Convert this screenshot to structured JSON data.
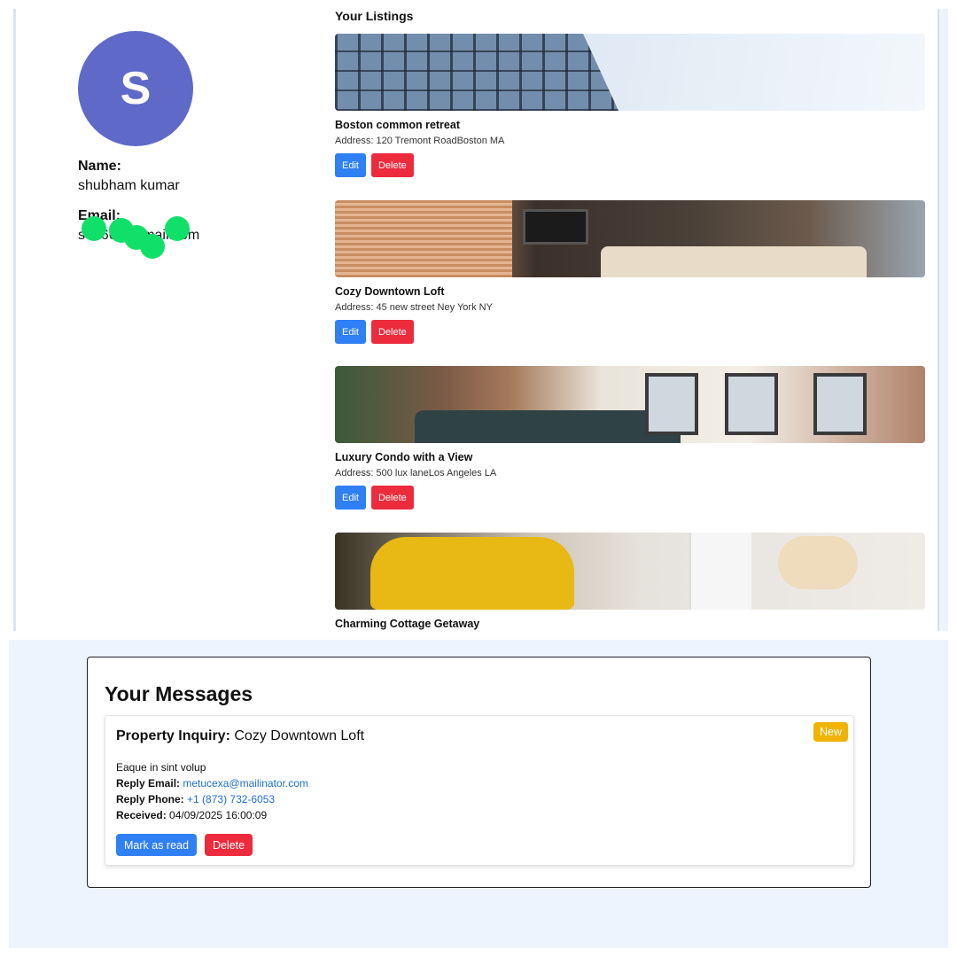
{
  "profile": {
    "avatar_initial": "S",
    "name_label": "Name:",
    "name_value": "shubham kumar",
    "email_label": "Email:",
    "email_value": "s  b     66  @gmail.com"
  },
  "listings": {
    "title": "Your Listings",
    "items": [
      {
        "name": "Boston common retreat",
        "address": "Address: 120 Tremont RoadBoston MA",
        "edit_label": "Edit",
        "delete_label": "Delete"
      },
      {
        "name": "Cozy Downtown Loft",
        "address": "Address: 45 new street Ney York NY",
        "edit_label": "Edit",
        "delete_label": "Delete"
      },
      {
        "name": "Luxury Condo with a View",
        "address": "Address: 500 lux laneLos Angeles LA",
        "edit_label": "Edit",
        "delete_label": "Delete"
      },
      {
        "name": "Charming Cottage Getaway"
      }
    ]
  },
  "messages": {
    "title": "Your Messages",
    "items": [
      {
        "subject_label": "Property Inquiry:",
        "subject_value": "Cozy Downtown Loft",
        "badge": "New",
        "body": "Eaque in sint volup",
        "reply_email_label": "Reply Email:",
        "reply_email": "metucexa@mailinator.com",
        "reply_phone_label": "Reply Phone:",
        "reply_phone": "+1 (873) 732-6053",
        "received_label": "Received:",
        "received": "04/09/2025 16:00:09",
        "mark_read_label": "Mark as read",
        "delete_label": "Delete"
      }
    ]
  },
  "colors": {
    "avatar_bg": "#5f6ac8",
    "primary": "#2f7ff5",
    "danger": "#ec2b3d",
    "badge": "#f0b300",
    "page_bg": "#edf4fd",
    "link": "#1f6fd6"
  }
}
